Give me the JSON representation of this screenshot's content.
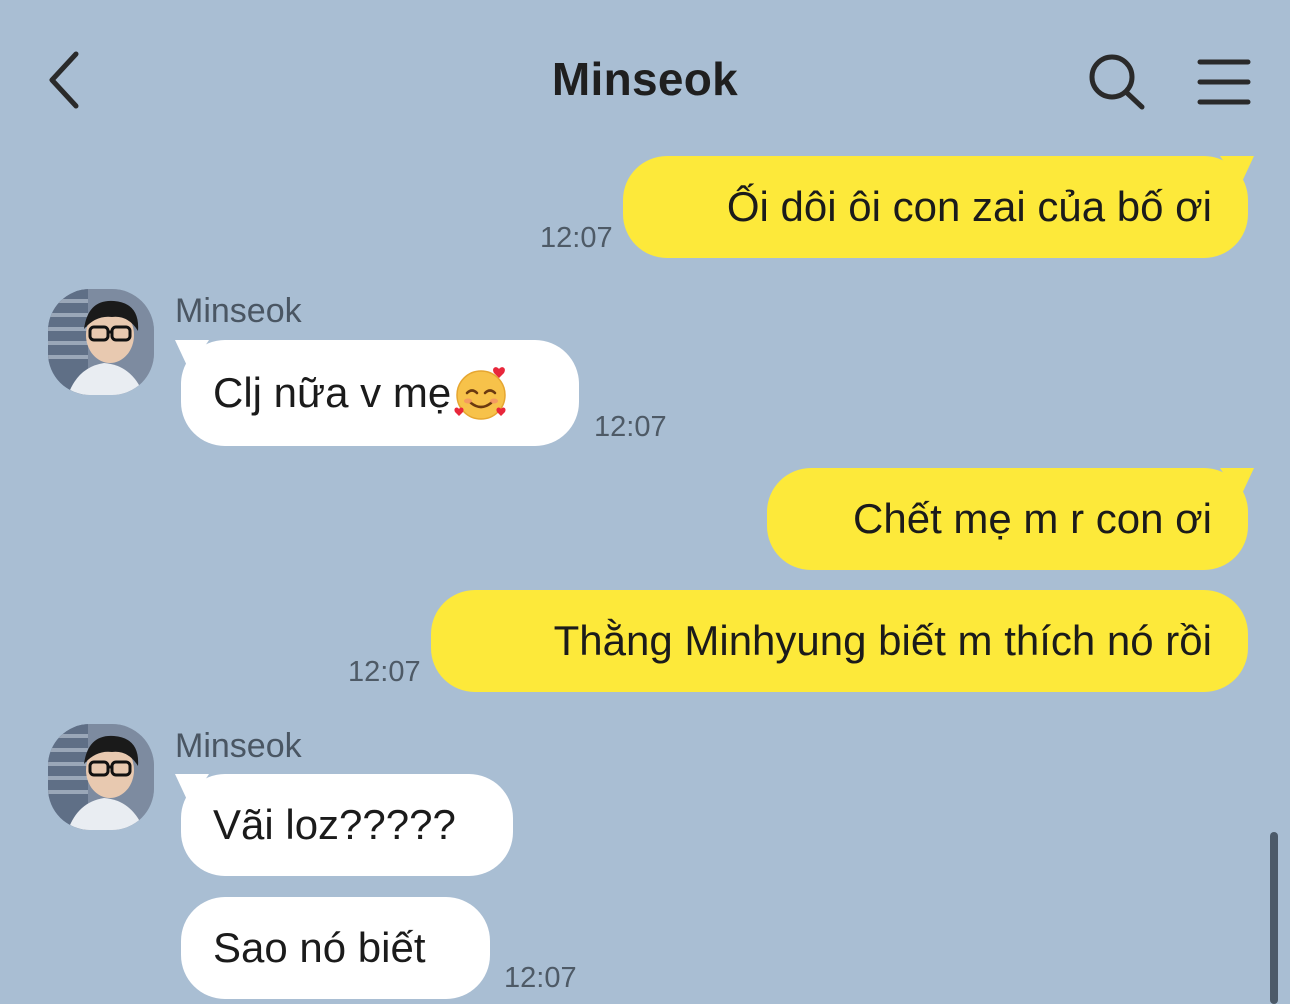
{
  "header": {
    "title": "Minseok",
    "back_icon": "chevron-left-icon",
    "search_icon": "search-icon",
    "menu_icon": "hamburger-menu-icon"
  },
  "colors": {
    "background": "#a9bed3",
    "my_bubble": "#fde93a",
    "their_bubble": "#ffffff"
  },
  "messages": [
    {
      "from": "me",
      "text": "Ối dôi ôi con zai của bố ơi",
      "time": "12:07"
    },
    {
      "from": "Minseok",
      "sender": "Minseok",
      "text": "Clj nữa v mẹ",
      "emoji": "smiling-face-with-hearts",
      "time": "12:07"
    },
    {
      "from": "me",
      "text": "Chết mẹ m r con ơi"
    },
    {
      "from": "me",
      "text": "Thằng Minhyung biết m thích nó rồi",
      "time": "12:07"
    },
    {
      "from": "Minseok",
      "sender": "Minseok",
      "text": "Vãi loz?????"
    },
    {
      "from": "Minseok",
      "text": "Sao nó biết",
      "time": "12:07"
    }
  ]
}
